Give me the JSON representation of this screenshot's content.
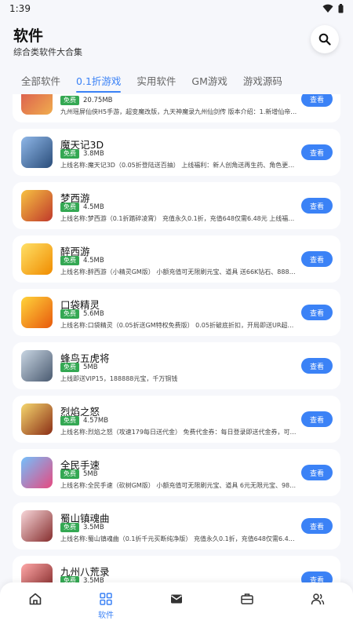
{
  "status": {
    "time": "1:39"
  },
  "header": {
    "title": "软件",
    "subtitle": "综合类软件大合集"
  },
  "tabs": [
    {
      "label": "全部软件",
      "active": false
    },
    {
      "label": "0.1折游戏",
      "active": true
    },
    {
      "label": "实用软件",
      "active": false
    },
    {
      "label": "GM游戏",
      "active": false
    },
    {
      "label": "游戏源码",
      "active": false
    }
  ],
  "list": {
    "free_label": "免费",
    "view_label": "查看",
    "items": [
      {
        "name": "",
        "size": "20.75MB",
        "desc": "九州瑶屏仙侠H5手游，超变魔改版，九天神魔录九州仙剑传 版本介绍：1.新增仙帝…"
      },
      {
        "name": "魔天记3D",
        "size": "3.8MB",
        "desc": "上线名称:魔天记3D（0.05折登陆送百抽） 上线福利：新人创角送再生药、角色更…"
      },
      {
        "name": "梦西游",
        "size": "4.5MB",
        "desc": "上线名称:梦西游（0.1折踏碎凌霄） 充值永久0.1折，充值648仅需6.48元 上线福…"
      },
      {
        "name": "醉西游",
        "size": "4.5MB",
        "desc": "上线名称:醉西游（小精灵GM版） 小额充值可无限刷元宝、道具 送66K钻石、888…"
      },
      {
        "name": "口袋精灵",
        "size": "5.6MB",
        "desc": "上线名称:口袋精灵（0.05折送GM特权免费版） 0.05折破底折扣，开局即送UR超…"
      },
      {
        "name": "蜂鸟五虎将",
        "size": "5MB",
        "desc": "上线即送VIP15，188888元宝，千万铜钱"
      },
      {
        "name": "烈焰之怒",
        "size": "4.57MB",
        "desc": "上线名称:烈焰之怒（攻速179每日送代金） 免费代金券：每日登录即送代金券，可…"
      },
      {
        "name": "全民手速",
        "size": "5MB",
        "desc": "上线名称:全民手速（砍树GM版） 小额充值可无限刷元宝、道具 6元无限元宝、98…"
      },
      {
        "name": "蜀山镇魂曲",
        "size": "3.5MB",
        "desc": "上线名称:蜀山镇魂曲（0.1折千元买断纯净版） 充值永久0.1折，充值648仅需6.4…"
      },
      {
        "name": "九州八荒录",
        "size": "3.5MB",
        "desc": ""
      }
    ]
  },
  "bottom_nav": {
    "items": [
      {
        "icon": "home-icon",
        "label": ""
      },
      {
        "icon": "apps-grid-icon",
        "label": "软件"
      },
      {
        "icon": "mail-icon",
        "label": ""
      },
      {
        "icon": "toolbox-icon",
        "label": ""
      },
      {
        "icon": "users-icon",
        "label": ""
      }
    ]
  },
  "colors": {
    "accent": "#3b82f6",
    "free_badge": "#34a853",
    "background": "#f6f7fb",
    "card": "#ffffff"
  }
}
